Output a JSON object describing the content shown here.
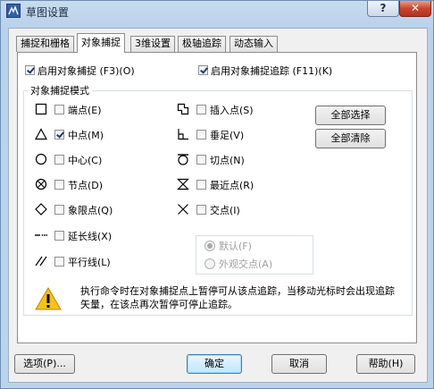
{
  "window": {
    "title": "草图设置",
    "help_glyph": "?",
    "close_glyph": "✕"
  },
  "tabs": [
    {
      "label": "捕捉和栅格"
    },
    {
      "label": "对象捕捉"
    },
    {
      "label": "3维设置"
    },
    {
      "label": "极轴追踪"
    },
    {
      "label": "动态输入"
    }
  ],
  "enable_snap": {
    "label": "启用对象捕捉 (F3)(O)",
    "checked": true
  },
  "enable_track": {
    "label": "启用对象捕捉追踪 (F11)(K)",
    "checked": true
  },
  "group_title": "对象捕捉模式",
  "modes_left": [
    {
      "label": "端点(E)",
      "checked": false,
      "icon": "square-icon"
    },
    {
      "label": "中点(M)",
      "checked": true,
      "icon": "triangle-icon"
    },
    {
      "label": "中心(C)",
      "checked": false,
      "icon": "circle-icon"
    },
    {
      "label": "节点(D)",
      "checked": false,
      "icon": "node-icon"
    },
    {
      "label": "象限点(Q)",
      "checked": false,
      "icon": "diamond-icon"
    },
    {
      "label": "延长线(X)",
      "checked": false,
      "icon": "extension-icon"
    },
    {
      "label": "平行线(L)",
      "checked": false,
      "icon": "parallel-icon"
    }
  ],
  "modes_right": [
    {
      "label": "插入点(S)",
      "checked": false,
      "icon": "insert-icon"
    },
    {
      "label": "垂足(V)",
      "checked": false,
      "icon": "perpendicular-icon"
    },
    {
      "label": "切点(N)",
      "checked": false,
      "icon": "tangent-icon"
    },
    {
      "label": "最近点(R)",
      "checked": false,
      "icon": "nearest-icon"
    },
    {
      "label": "交点(I)",
      "checked": false,
      "icon": "intersection-icon"
    }
  ],
  "select_all": "全部选择",
  "clear_all": "全部清除",
  "radio_options": [
    {
      "label": "默认(F)",
      "selected": true
    },
    {
      "label": "外观交点(A)",
      "selected": false
    }
  ],
  "info_text": "执行命令时在对象捕捉点上暂停可从该点追踪，当移动光标时会出现追踪矢量，在该点再次暂停可停止追踪。",
  "footer": {
    "options": "选项(P)...",
    "ok": "确定",
    "cancel": "取消",
    "help": "帮助(H)"
  }
}
